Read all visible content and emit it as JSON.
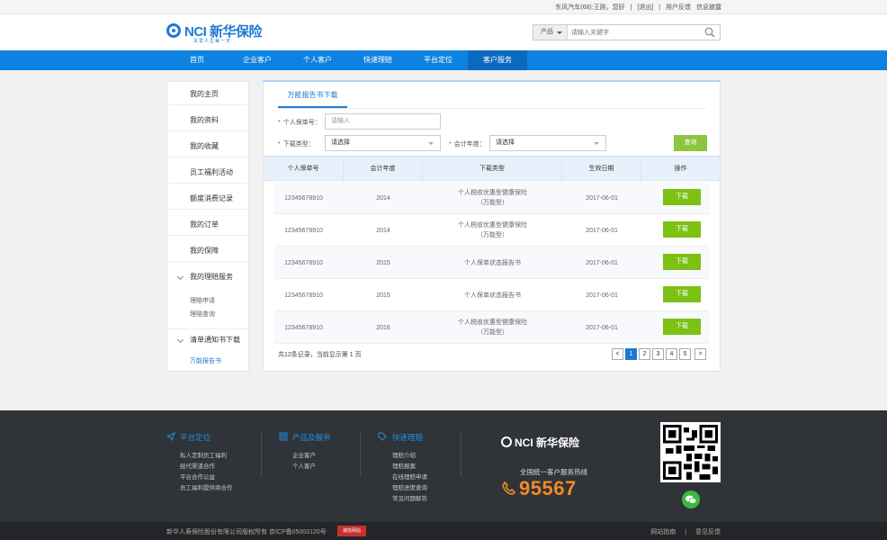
{
  "topbar": {
    "greeting": "东风汽车(68):王刚，您好",
    "logout": "[退出]",
    "feedback": "用户反馈",
    "info_disclosure": "信息披露"
  },
  "brand": {
    "name": "NCI 新华保险",
    "slogan": "关爱人生每一天",
    "color": "#1e7ad3"
  },
  "search": {
    "category": "产品",
    "placeholder": "请输入关键字",
    "icon": "search-icon"
  },
  "nav": {
    "items": [
      "首页",
      "企业客户",
      "个人客户",
      "快速理赔",
      "平台定位",
      "客户服务"
    ],
    "active": "客户服务",
    "color": "#0d82e0"
  },
  "sidebar": {
    "items": [
      "我的主页",
      "我的资料",
      "我的收藏",
      "员工福利活动",
      "额度消费记录",
      "我的订单",
      "我的保障"
    ],
    "groups": [
      {
        "label": "我的理赔服务",
        "subs": [
          "理赔申请",
          "理赔查询"
        ]
      },
      {
        "label": "清单通知书下载",
        "subs": [
          "万能报告书"
        ]
      }
    ],
    "active_sub": "万能报告书"
  },
  "main": {
    "tab": "万能报告书下载",
    "form": {
      "policy_label": "个人保单号：",
      "policy_placeholder": "请输入",
      "type_label": "下载类型：",
      "type_value": "请选择",
      "year_label": "会计年度：",
      "year_value": "请选择",
      "query_button": "查询"
    },
    "table": {
      "headers": [
        "个人保单号",
        "会计年度",
        "下载类型",
        "生效日期",
        "操作"
      ],
      "rows": [
        {
          "policy": "12345678910",
          "year": "2014",
          "type": "个人税收优惠型健康保险\n（万能型）",
          "date": "2017-06-01",
          "action": "下载"
        },
        {
          "policy": "12345678910",
          "year": "2014",
          "type": "个人税收优惠型健康保险\n（万能型）",
          "date": "2017-06-01",
          "action": "下载"
        },
        {
          "policy": "12345678910",
          "year": "2015",
          "type": "个人保单状态报告书",
          "date": "2017-06-01",
          "action": "下载"
        },
        {
          "policy": "12345678910",
          "year": "2015",
          "type": "个人保单状态报告书",
          "date": "2017-06-01",
          "action": "下载"
        },
        {
          "policy": "12345678910",
          "year": "2016",
          "type": "个人税收优惠型健康保险\n（万能型）",
          "date": "2017-06-01",
          "action": "下载"
        }
      ]
    },
    "summary": "共12条记录，当前显示第 1 页",
    "pagination": {
      "prev": "<",
      "pages": [
        "1",
        "2",
        "3",
        "4",
        "5"
      ],
      "next": ">",
      "current": "1"
    }
  },
  "footer": {
    "columns": [
      {
        "title": "平台定位",
        "icon": "send-icon",
        "items": [
          "私人定制员工福利",
          "经代渠道合作",
          "平台合作公益",
          "员工福利提供商合作"
        ]
      },
      {
        "title": "产品及服务",
        "icon": "grid-icon",
        "items": [
          "企业客户",
          "个人客户"
        ]
      },
      {
        "title": "快速理赔",
        "icon": "tag-icon",
        "items": [
          "理赔介绍",
          "理赔报案",
          "在线理赔申请",
          "理赔进度查询",
          "常见问题解答"
        ]
      }
    ],
    "logo": "NCI 新华保险",
    "hotline_label": "全国统一客户服务热线",
    "hotline": "95567",
    "qr_icon": "qr-code-icon",
    "wechat_icon": "wechat-icon"
  },
  "bottom": {
    "copyright": "新华人寿保险股份有限公司版权所有  京ICP备05003120号",
    "badge": "诚信网站",
    "links": [
      "网站指南",
      "意见反馈"
    ]
  }
}
